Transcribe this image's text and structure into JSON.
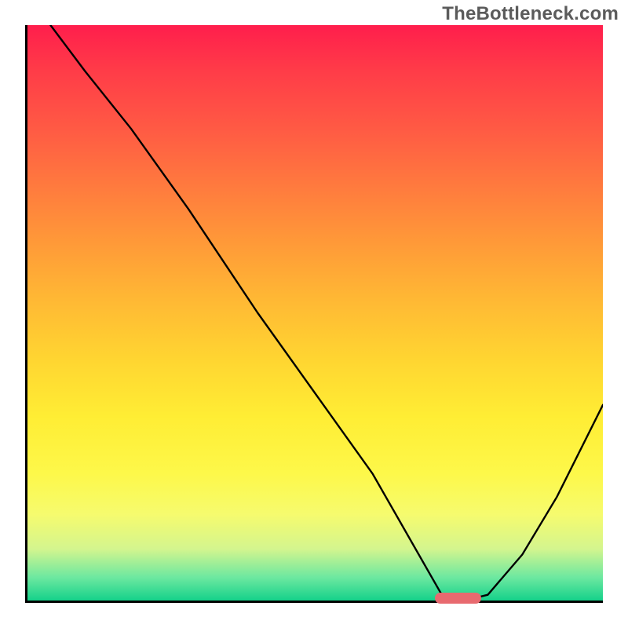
{
  "watermark": "TheBottleneck.com",
  "chart_data": {
    "type": "line",
    "title": "",
    "xlabel": "",
    "ylabel": "",
    "xlim": [
      0,
      100
    ],
    "ylim": [
      0,
      100
    ],
    "grid": false,
    "legend": false,
    "background_gradient": {
      "top": "#ff1e4c",
      "mid": "#ffd531",
      "bottom": "#14d18a",
      "direction": "vertical"
    },
    "marker": {
      "x_start": 70.5,
      "x_end": 78.5,
      "y": 0.8,
      "color": "#e86a6f"
    },
    "series": [
      {
        "name": "curve",
        "color": "#000000",
        "x": [
          4,
          10,
          18,
          28,
          40,
          50,
          60,
          68,
          72,
          76,
          80,
          86,
          92,
          100
        ],
        "y": [
          100,
          92,
          82,
          68,
          50,
          36,
          22,
          8,
          1,
          0,
          1,
          8,
          18,
          34
        ]
      }
    ]
  }
}
